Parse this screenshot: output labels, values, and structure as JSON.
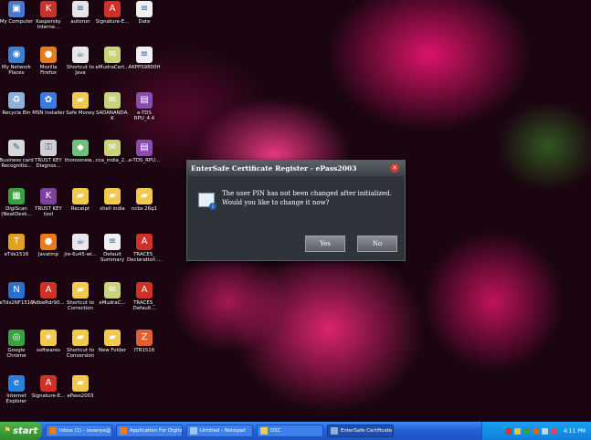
{
  "desktop_icons": [
    {
      "label": "My Computer",
      "icon": "computer-icon",
      "color": "#4a78c8",
      "glyph": "▣"
    },
    {
      "label": "Kaspersky Interne...",
      "icon": "kaspersky-icon",
      "color": "#c8322a",
      "glyph": "K"
    },
    {
      "label": "autorun",
      "icon": "file-icon",
      "color": "#e6e6e6",
      "glyph": "≡"
    },
    {
      "label": "Signature-E...",
      "icon": "pdf-icon",
      "color": "#d03028",
      "glyph": "A"
    },
    {
      "label": "Date",
      "icon": "document-icon",
      "color": "#f0f0f0",
      "glyph": "≡"
    },
    {
      "label": "My Network Places",
      "icon": "network-icon",
      "color": "#3f7fd0",
      "glyph": "◉"
    },
    {
      "label": "Mozilla Firefox",
      "icon": "firefox-icon",
      "color": "#e87a1f",
      "glyph": "●"
    },
    {
      "label": "Shortcut to Java",
      "icon": "java-icon",
      "color": "#e8e8e8",
      "glyph": "☕"
    },
    {
      "label": "eMudraCert...",
      "icon": "certificate-icon",
      "color": "#c9d37a",
      "glyph": "✉"
    },
    {
      "label": "AKPPS9800H",
      "icon": "document-icon",
      "color": "#f0f0f0",
      "glyph": "≡"
    },
    {
      "label": "Recycle Bin",
      "icon": "recycle-bin-icon",
      "color": "#8fb0d8",
      "glyph": "♻"
    },
    {
      "label": "MSN Installer",
      "icon": "msn-icon",
      "color": "#3a7be0",
      "glyph": "✿"
    },
    {
      "label": "Safe Money",
      "icon": "folder-icon",
      "color": "#f2c94c",
      "glyph": "▰"
    },
    {
      "label": "SADANANDA.K",
      "icon": "certificate-icon",
      "color": "#c9d37a",
      "glyph": "✉"
    },
    {
      "label": "e-TDS RPU_4.4",
      "icon": "rar-icon",
      "color": "#8a4bb0",
      "glyph": "▤"
    },
    {
      "label": "Business card Recognitio...",
      "icon": "scanner-icon",
      "color": "#d8d8d8",
      "glyph": "✎"
    },
    {
      "label": "TRUST KEY Diagnos...",
      "icon": "key-icon",
      "color": "#d0d0d0",
      "glyph": "⚿"
    },
    {
      "label": "thonsonew...",
      "icon": "gem-icon",
      "color": "#6fc07a",
      "glyph": "◆"
    },
    {
      "label": "cca_india_2...",
      "icon": "certificate-icon",
      "color": "#c9d37a",
      "glyph": "✉"
    },
    {
      "label": "e-TDS_RPU...",
      "icon": "rar-icon",
      "color": "#8a4bb0",
      "glyph": "▤"
    },
    {
      "label": "DigiScan (NeatDesk...",
      "icon": "digiscan-icon",
      "color": "#3aa040",
      "glyph": "▦"
    },
    {
      "label": "TRUST KEY tool",
      "icon": "trustkey-icon",
      "color": "#8040a0",
      "glyph": "K"
    },
    {
      "label": "Receipt",
      "icon": "folder-icon",
      "color": "#f2c94c",
      "glyph": "▰"
    },
    {
      "label": "shell india",
      "icon": "folder-icon",
      "color": "#f2c94c",
      "glyph": "▰"
    },
    {
      "label": "ncbs 26q1",
      "icon": "folder-icon",
      "color": "#f2c94c",
      "glyph": "▰"
    },
    {
      "label": "eTds1516",
      "icon": "tds-icon",
      "color": "#e0a020",
      "glyph": "T"
    },
    {
      "label": "Javatmp",
      "icon": "firefox-icon",
      "color": "#e87a1f",
      "glyph": "●"
    },
    {
      "label": "jre-6u45-wi...",
      "icon": "installer-icon",
      "color": "#e8e8e8",
      "glyph": "☕"
    },
    {
      "label": "Default Summary",
      "icon": "document-icon",
      "color": "#f0f0f0",
      "glyph": "≡"
    },
    {
      "label": "TRACES_ Declaration ...",
      "icon": "pdf-icon",
      "color": "#d03028",
      "glyph": "A"
    },
    {
      "label": "eTds2NF1516",
      "icon": "tds-icon",
      "color": "#2a6fd0",
      "glyph": "N"
    },
    {
      "label": "AdbeRdr90...",
      "icon": "adobe-reader-icon",
      "color": "#d03028",
      "glyph": "A"
    },
    {
      "label": "Shortcut to Correction",
      "icon": "folder-icon",
      "color": "#f2c94c",
      "glyph": "▰"
    },
    {
      "label": "eMudraC...",
      "icon": "certificate-icon",
      "color": "#c9d37a",
      "glyph": "✉"
    },
    {
      "label": "TRACES_ Default...",
      "icon": "pdf-icon",
      "color": "#d03028",
      "glyph": "A"
    },
    {
      "label": "Google Chrome",
      "icon": "chrome-icon",
      "color": "#3aa040",
      "glyph": "◎"
    },
    {
      "label": "softwares",
      "icon": "star-folder-icon",
      "color": "#f2c94c",
      "glyph": "★"
    },
    {
      "label": "Shortcut to Conversion",
      "icon": "folder-icon",
      "color": "#f2c94c",
      "glyph": "▰"
    },
    {
      "label": "New Folder",
      "icon": "folder-icon",
      "color": "#f2c94c",
      "glyph": "▰"
    },
    {
      "label": "ITR1516",
      "icon": "itr-icon",
      "color": "#e06030",
      "glyph": "Z"
    },
    {
      "label": "Internet Explorer",
      "icon": "internet-explorer-icon",
      "color": "#2a7fd8",
      "glyph": "e"
    },
    {
      "label": "Signature-E...",
      "icon": "pdf-icon",
      "color": "#d03028",
      "glyph": "A"
    },
    {
      "label": "ePass2003",
      "icon": "folder-icon",
      "color": "#f2c94c",
      "glyph": "▰"
    }
  ],
  "dialog": {
    "title": "EnterSafe Certificate Register - ePass2003",
    "message": "The user PIN has not been changed after initialized. Would you like to change it now?",
    "yes_label": "Yes",
    "no_label": "No"
  },
  "taskbar": {
    "start_label": "start",
    "tasks": [
      {
        "label": "Inbox (1) - lavanya@...",
        "icon": "firefox-icon",
        "color": "#e87a1f",
        "active": false
      },
      {
        "label": "Application For Digital...",
        "icon": "firefox-icon",
        "color": "#e87a1f",
        "active": false
      },
      {
        "label": "Untitled - Notepad",
        "icon": "notepad-icon",
        "color": "#9fc6f0",
        "active": false
      },
      {
        "label": "DSC",
        "icon": "folder-icon",
        "color": "#f2c94c",
        "active": false
      },
      {
        "label": "EnterSafe Certificate ...",
        "icon": "certificate-icon",
        "color": "#8fb0d8",
        "active": true
      }
    ],
    "clock": "4:11 PM"
  }
}
